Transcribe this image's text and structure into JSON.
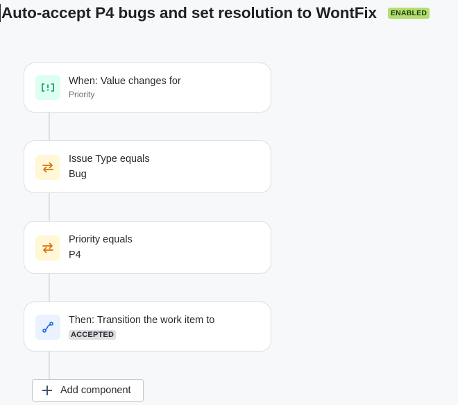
{
  "header": {
    "title": "Auto-accept P4 bugs and set resolution to WontFix",
    "status_badge": "ENABLED"
  },
  "flow": {
    "trigger": {
      "icon": "trigger-icon",
      "title": "When: Value changes for",
      "detail": "Priority"
    },
    "conditions": [
      {
        "icon": "compare-icon",
        "title": "Issue Type equals",
        "value": "Bug"
      },
      {
        "icon": "compare-icon",
        "title": "Priority equals",
        "value": "P4"
      }
    ],
    "action": {
      "icon": "transition-icon",
      "title": "Then: Transition the work item to",
      "status": "ACCEPTED"
    }
  },
  "add_component": {
    "label": "Add component"
  },
  "colors": {
    "trigger_icon_bg": "#dcfff1",
    "trigger_icon": "#22a06b",
    "condition_icon_bg": "#fff7d6",
    "condition_icon": "#d97008",
    "action_icon_bg": "#e9f2fe",
    "action_icon": "#1868db",
    "enabled_badge": "#b3df72"
  }
}
